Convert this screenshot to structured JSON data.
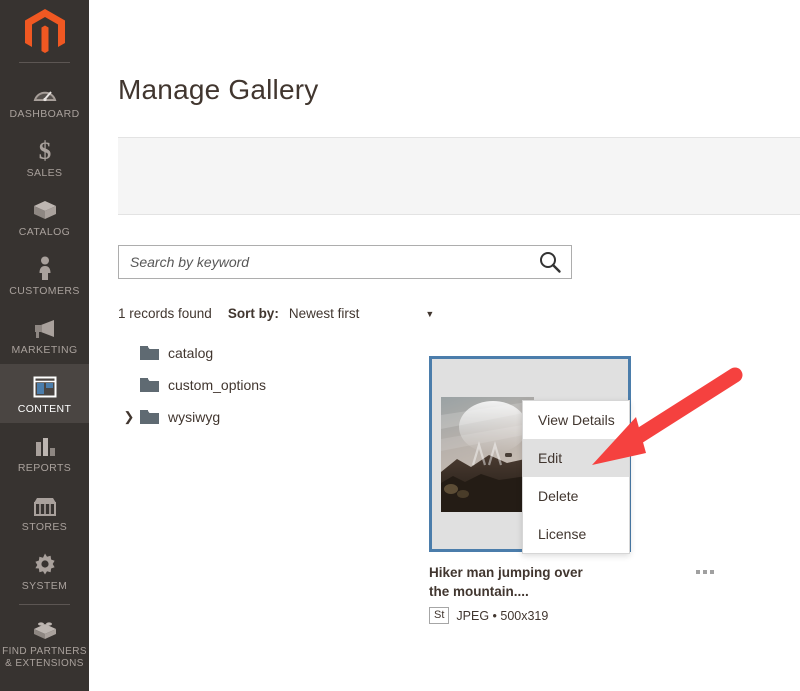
{
  "sidebar": {
    "logo": "magento-logo",
    "items": [
      {
        "label": "DASHBOARD",
        "icon": "dashboard-gauge-icon",
        "active": false
      },
      {
        "label": "SALES",
        "icon": "dollar-sign-icon",
        "active": false
      },
      {
        "label": "CATALOG",
        "icon": "box-icon",
        "active": false
      },
      {
        "label": "CUSTOMERS",
        "icon": "person-icon",
        "active": false
      },
      {
        "label": "MARKETING",
        "icon": "megaphone-icon",
        "active": false
      },
      {
        "label": "CONTENT",
        "icon": "layout-panel-icon",
        "active": true
      },
      {
        "label": "REPORTS",
        "icon": "bar-chart-icon",
        "active": false
      },
      {
        "label": "STORES",
        "icon": "storefront-icon",
        "active": false
      },
      {
        "label": "SYSTEM",
        "icon": "gear-icon",
        "active": false
      },
      {
        "label": "FIND PARTNERS\n& EXTENSIONS",
        "icon": "lego-brick-icon",
        "active": false
      }
    ],
    "item_labels": {
      "dashboard": "DASHBOARD",
      "sales": "SALES",
      "catalog": "CATALOG",
      "customers": "CUSTOMERS",
      "marketing": "MARKETING",
      "content": "CONTENT",
      "reports": "REPORTS",
      "stores": "STORES",
      "system": "SYSTEM",
      "find_partners_line1": "FIND PARTNERS",
      "find_partners_line2": "& EXTENSIONS"
    }
  },
  "page": {
    "title": "Manage Gallery"
  },
  "search": {
    "placeholder": "Search by keyword",
    "value": "",
    "icon": "search-icon"
  },
  "results": {
    "records_found": "1 records found",
    "sort_by_label": "Sort by:",
    "sort_value": "Newest first",
    "sort_caret": "▼",
    "sort_options": [
      "Newest first"
    ]
  },
  "folder_tree": [
    {
      "name": "catalog",
      "expandable": false,
      "chevron": ""
    },
    {
      "name": "custom_options",
      "expandable": false,
      "chevron": ""
    },
    {
      "name": "wysiwyg",
      "expandable": true,
      "chevron": "❯"
    }
  ],
  "asset": {
    "title": "Hiker man jumping over the mountain....",
    "source_badge": "St",
    "format": "JPEG",
    "separator": "•",
    "dimensions": "500x319",
    "meta_line": "JPEG • 500x319",
    "more_icon": "three-dots-icon",
    "selected": true
  },
  "context_menu": {
    "items": [
      {
        "label": "View Details",
        "highlighted": false
      },
      {
        "label": "Edit",
        "highlighted": true
      },
      {
        "label": "Delete",
        "highlighted": false
      },
      {
        "label": "License",
        "highlighted": false
      }
    ]
  },
  "annotation": {
    "type": "red-arrow",
    "color": "#f5413f",
    "points_to": "Edit"
  },
  "colors": {
    "sidebar_bg": "#373330",
    "sidebar_active": "#4a4542",
    "brand_orange": "#f05822",
    "card_border": "#4b7dab",
    "panel_bg": "#f5f5f5",
    "text": "#41362f",
    "arrow_red": "#f5413f"
  }
}
